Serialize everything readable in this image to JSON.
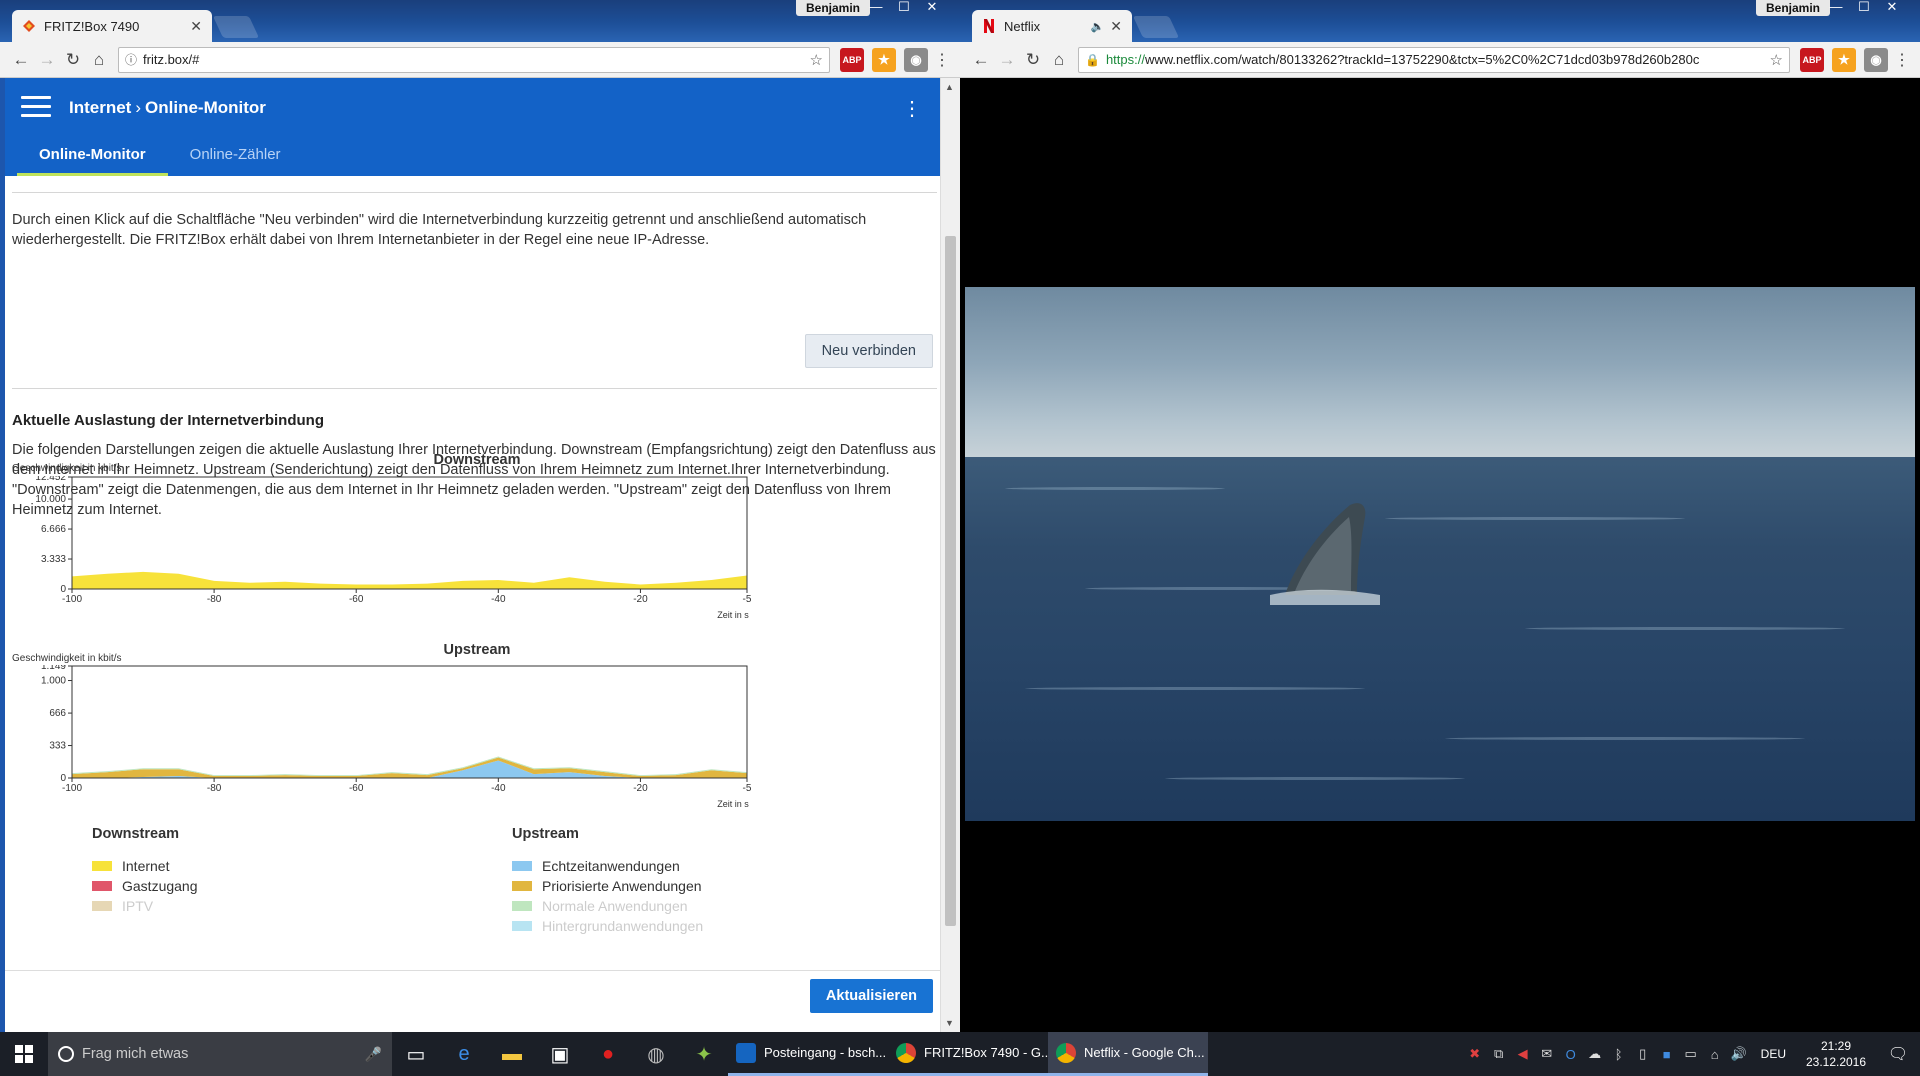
{
  "left_window": {
    "tab_title": "FRITZ!Box 7490",
    "profile": "Benjamin",
    "url": "fritz.box/#",
    "extensions": {
      "abp": "ABP"
    },
    "header": {
      "breadcrumb_parent": "Internet",
      "breadcrumb_current": "Online-Monitor"
    },
    "tabs": [
      "Online-Monitor",
      "Online-Zähler"
    ],
    "reconnect_text": "Durch einen Klick auf die Schaltfläche \"Neu verbinden\" wird die Internetverbindung kurzzeitig getrennt und anschließend automatisch wiederhergestellt. Die FRITZ!Box erhält dabei von Ihrem Internetanbieter in der Regel eine neue IP-Adresse.",
    "reconnect_button": "Neu verbinden",
    "section_title": "Aktuelle Auslastung der Internetverbindung",
    "section_text": "Die folgenden Darstellungen zeigen die aktuelle Auslastung Ihrer Internetverbindung. Downstream (Empfangsrichtung) zeigt den Datenfluss aus dem Internet in Ihr Heimnetz. Upstream (Senderichtung) zeigt den Datenfluss von Ihrem Heimnetz zum Internet.Ihrer Internetverbindung. \"Downstream\" zeigt die Datenmengen, die aus dem Internet in Ihr Heimnetz geladen werden. \"Upstream\" zeigt den Datenfluss von Ihrem Heimnetz zum Internet.",
    "legend": {
      "downstream_title": "Downstream",
      "upstream_title": "Upstream",
      "downstream_items": [
        {
          "label": "Internet",
          "color": "#f7e23a"
        },
        {
          "label": "Gastzugang",
          "color": "#e0566a"
        },
        {
          "label": "IPTV",
          "color": "#e6d7b5"
        }
      ],
      "upstream_items": [
        {
          "label": "Echtzeitanwendungen",
          "color": "#8cc8f0"
        },
        {
          "label": "Priorisierte Anwendungen",
          "color": "#e1b63f"
        },
        {
          "label": "Normale Anwendungen",
          "color": "#bfe6bf"
        },
        {
          "label": "Hintergrundanwendungen",
          "color": "#b8e4f2"
        }
      ]
    },
    "refresh_button": "Aktualisieren"
  },
  "chart_data": [
    {
      "type": "area",
      "title": "Downstream",
      "ylabel": "Geschwindigkeit in kbit/s",
      "xlabel": "Zeit in s",
      "x_ticks": [
        -100,
        -80,
        -60,
        -40,
        -20,
        -5
      ],
      "y_ticks": [
        "0",
        "3.333",
        "6.666",
        "10.000",
        "12.452"
      ],
      "xlim": [
        -100,
        -5
      ],
      "ylim": [
        0,
        12452
      ],
      "series": [
        {
          "name": "Internet",
          "color": "#f7e23a",
          "x": [
            -100,
            -95,
            -90,
            -85,
            -80,
            -75,
            -70,
            -65,
            -60,
            -55,
            -50,
            -45,
            -40,
            -35,
            -30,
            -25,
            -20,
            -15,
            -10,
            -5
          ],
          "values": [
            1400,
            1700,
            1900,
            1700,
            900,
            700,
            800,
            600,
            500,
            500,
            600,
            900,
            1000,
            700,
            1300,
            800,
            500,
            700,
            1000,
            1500
          ]
        }
      ]
    },
    {
      "type": "area",
      "title": "Upstream",
      "ylabel": "Geschwindigkeit in kbit/s",
      "xlabel": "Zeit in s",
      "x_ticks": [
        -100,
        -80,
        -60,
        -40,
        -20,
        -5
      ],
      "y_ticks": [
        "0",
        "333",
        "666",
        "1.000",
        "1.149"
      ],
      "xlim": [
        -100,
        -5
      ],
      "ylim": [
        0,
        1149
      ],
      "series": [
        {
          "name": "Echtzeitanwendungen",
          "color": "#8cc8f0",
          "x": [
            -100,
            -95,
            -90,
            -85,
            -80,
            -75,
            -70,
            -65,
            -60,
            -55,
            -50,
            -45,
            -40,
            -35,
            -30,
            -25,
            -20,
            -15,
            -10,
            -5
          ],
          "values": [
            0,
            0,
            10,
            20,
            0,
            0,
            0,
            0,
            0,
            0,
            0,
            80,
            180,
            40,
            60,
            20,
            0,
            0,
            0,
            0
          ]
        },
        {
          "name": "Priorisierte Anwendungen",
          "color": "#e1b63f",
          "x": [
            -100,
            -95,
            -90,
            -85,
            -80,
            -75,
            -70,
            -65,
            -60,
            -55,
            -50,
            -45,
            -40,
            -35,
            -30,
            -25,
            -20,
            -15,
            -10,
            -5
          ],
          "values": [
            40,
            60,
            80,
            70,
            20,
            20,
            30,
            20,
            20,
            50,
            30,
            20,
            30,
            50,
            40,
            40,
            20,
            30,
            80,
            50
          ]
        },
        {
          "name": "Normale Anwendungen",
          "color": "#bfe6bf",
          "x": [
            -100,
            -95,
            -90,
            -85,
            -80,
            -75,
            -70,
            -65,
            -60,
            -55,
            -50,
            -45,
            -40,
            -35,
            -30,
            -25,
            -20,
            -15,
            -10,
            -5
          ],
          "values": [
            10,
            10,
            10,
            10,
            10,
            10,
            10,
            10,
            10,
            10,
            10,
            10,
            10,
            10,
            10,
            10,
            10,
            10,
            10,
            10
          ]
        }
      ]
    }
  ],
  "right_window": {
    "tab_title": "Netflix",
    "profile": "Benjamin",
    "url_https": "https://",
    "url_rest": "www.netflix.com/watch/80133262?trackId=13752290&tctx=5%2C0%2C71dcd03b978d260b280c",
    "ext_abp": "ABP"
  },
  "taskbar": {
    "search_placeholder": "Frag mich etwas",
    "apps": [
      {
        "label": "Posteingang - bsch...",
        "color": "#1565c0"
      },
      {
        "label": "FRITZ!Box 7490 - G...",
        "color": "#e0b000"
      },
      {
        "label": "Netflix - Google Ch...",
        "color": "#d13b2f"
      }
    ],
    "language": "DEU",
    "time": "21:29",
    "date": "23.12.2016"
  }
}
